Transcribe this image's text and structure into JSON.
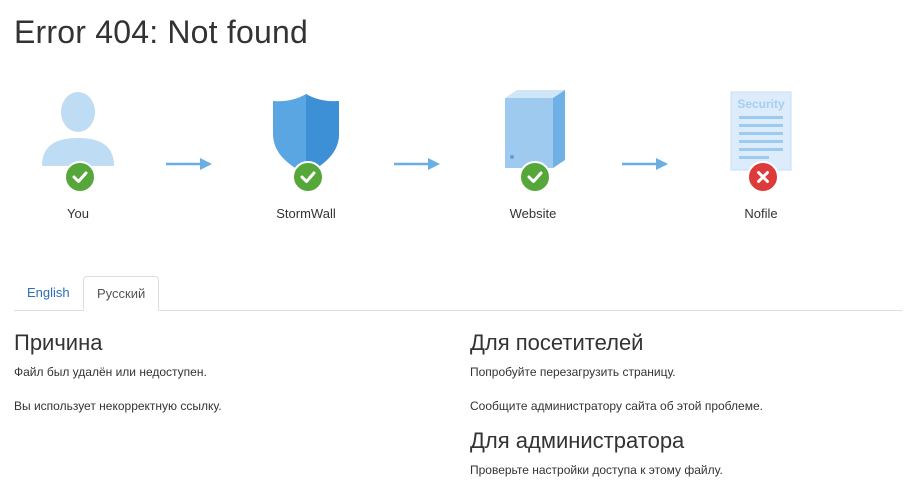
{
  "title": "Error 404: Not found",
  "flow": {
    "nodes": [
      {
        "label": "You",
        "icon": "user-icon",
        "status": "ok"
      },
      {
        "label": "StormWall",
        "icon": "shield-icon",
        "status": "ok"
      },
      {
        "label": "Website",
        "icon": "server-icon",
        "status": "ok"
      },
      {
        "label": "Nofile",
        "icon": "document-icon",
        "status": "error",
        "icon_text": "Security"
      }
    ],
    "arrow_color": "#6aaee2",
    "ok_color": "#55a73a",
    "error_color": "#dd3b3b"
  },
  "tabs": [
    {
      "label": "English",
      "active": false
    },
    {
      "label": "Русский",
      "active": true
    }
  ],
  "reason": {
    "heading": "Причина",
    "lines": [
      "Файл был удалён или недоступен.",
      "Вы использует некорректную ссылку."
    ]
  },
  "visitors": {
    "heading": "Для посетителей",
    "lines": [
      "Попробуйте перезагрузить страницу.",
      "Сообщите администратору сайта об этой проблеме."
    ]
  },
  "admin": {
    "heading": "Для администратора",
    "lines": [
      "Проверьте настройки доступа к этому файлу."
    ]
  }
}
